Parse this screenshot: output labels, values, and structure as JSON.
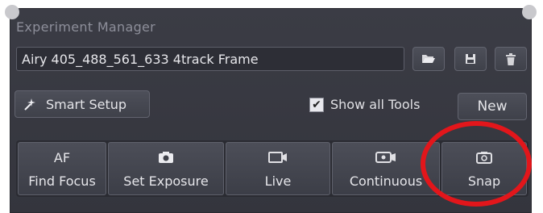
{
  "panel": {
    "title": "Experiment Manager"
  },
  "experiment": {
    "current": "Airy 405_488_561_633 4track Frame"
  },
  "toolbar": {
    "open_icon": "folder-open-icon",
    "save_icon": "floppy-save-icon",
    "delete_icon": "trash-icon"
  },
  "setup": {
    "smart_setup_label": "Smart Setup",
    "show_all_tools_label": "Show all Tools",
    "show_all_tools_checked": true,
    "new_label": "New"
  },
  "actions": [
    {
      "top": "AF",
      "label": "Find Focus",
      "icon": "af-text"
    },
    {
      "label": "Set Exposure",
      "icon": "camera-icon"
    },
    {
      "label": "Live",
      "icon": "video-icon"
    },
    {
      "label": "Continuous",
      "icon": "continuous-video-icon"
    },
    {
      "label": "Snap",
      "icon": "camera-icon"
    }
  ],
  "annotation": {
    "highlight_color": "#e2161b"
  }
}
